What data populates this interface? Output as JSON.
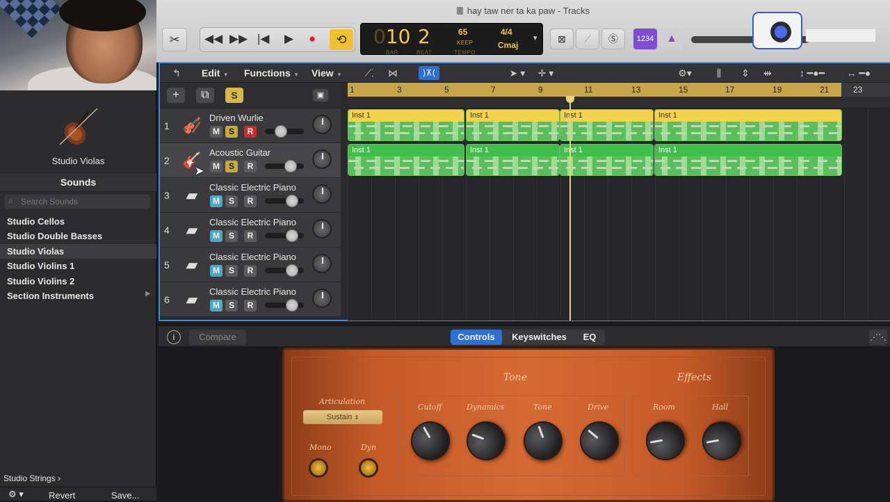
{
  "window": {
    "title": "hay taw ner ta ka paw - Tracks"
  },
  "lcd": {
    "bar": "10",
    "bar_prefix": "0",
    "beat": "2",
    "bar_label": "BAR",
    "beat_label": "BEAT",
    "tempo": "65",
    "tempo_sub": "KEEP",
    "tempo_label": "TEMPO",
    "sig": "4/4",
    "key": "Cmaj"
  },
  "count_in": "1234",
  "library": {
    "instrument": "Studio Violas",
    "sounds_header": "Sounds",
    "search_placeholder": "Search Sounds",
    "items": [
      {
        "label": "Studio Cellos"
      },
      {
        "label": "Studio Double Basses"
      },
      {
        "label": "Studio Violas"
      },
      {
        "label": "Studio Violins 1"
      },
      {
        "label": "Studio Violins 2"
      },
      {
        "label": "Section Instruments"
      }
    ],
    "breadcrumb": "Studio Strings",
    "revert": "Revert",
    "save": "Save..."
  },
  "menubar": {
    "edit": "Edit",
    "functions": "Functions",
    "view": "View"
  },
  "ruler": [
    "1",
    "3",
    "5",
    "7",
    "9",
    "11",
    "13",
    "15",
    "17",
    "19",
    "21",
    "23"
  ],
  "global_solo": "S",
  "tracks": [
    {
      "num": "1",
      "name": "Driven Wurlie",
      "m": "M",
      "s": "S",
      "r": "R"
    },
    {
      "num": "2",
      "name": "Acoustic Guitar",
      "m": "M",
      "s": "S",
      "r": "R"
    },
    {
      "num": "3",
      "name": "Classic Electric Piano",
      "m": "M",
      "s": "S",
      "r": "R"
    },
    {
      "num": "4",
      "name": "Classic Electric Piano",
      "m": "M",
      "s": "S",
      "r": "R"
    },
    {
      "num": "5",
      "name": "Classic Electric Piano",
      "m": "M",
      "s": "S",
      "r": "R"
    },
    {
      "num": "6",
      "name": "Classic Electric Piano",
      "m": "M",
      "s": "S",
      "r": "R"
    }
  ],
  "region_label": "Inst 1",
  "smart_controls": {
    "compare": "Compare",
    "tabs": [
      "Controls",
      "Keyswitches",
      "EQ"
    ],
    "tone_title": "Tone",
    "effects_title": "Effects",
    "articulation_label": "Articulation",
    "articulation_value": "Sustain",
    "mono": "Mono",
    "dyn": "Dyn",
    "knobs": [
      "Cutoff",
      "Dynamics",
      "Tone",
      "Drive",
      "Room",
      "Hall"
    ]
  }
}
